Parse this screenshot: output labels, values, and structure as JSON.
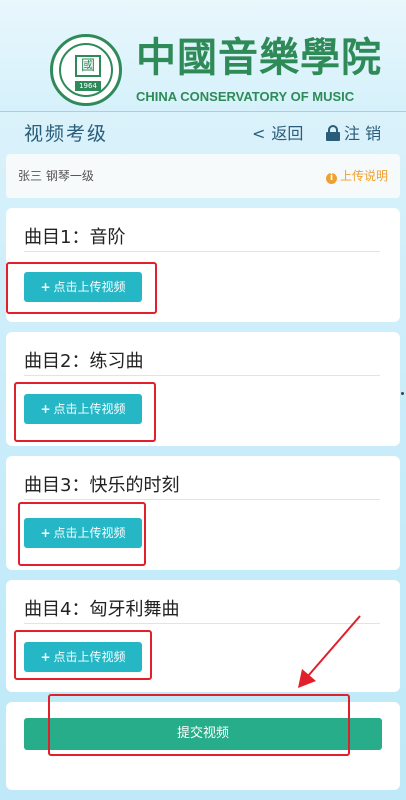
{
  "brand": {
    "logo_char": "國",
    "logo_year": "1964",
    "name_cn": "中國音樂學院",
    "name_en": "CHINA CONSERVATORY OF MUSIC"
  },
  "nav": {
    "title": "视频考级",
    "back_chevron": "<",
    "back_label": "返回",
    "logout_label": "注 销"
  },
  "info": {
    "student": "张三  钢琴一级",
    "help_icon": "i",
    "help_label": "上传说明"
  },
  "pieces": [
    {
      "title": "曲目1：音阶",
      "button": "点击上传视频"
    },
    {
      "title": "曲目2：练习曲",
      "button": "点击上传视频"
    },
    {
      "title": "曲目3：快乐的时刻",
      "button": "点击上传视频"
    },
    {
      "title": "曲目4：匈牙利舞曲",
      "button": "点击上传视频"
    }
  ],
  "upload_plus": "+",
  "submit_label": "提交视频",
  "colors": {
    "upload_button": "#25b7c6",
    "submit_button": "#27ad8a",
    "brand_green": "#2e8b57",
    "annotation_red": "#e0202a",
    "help_orange": "#f0a030"
  },
  "icons": [
    "lock-icon",
    "info-icon",
    "plus-icon",
    "chevron-left-icon",
    "annotation-arrow"
  ]
}
